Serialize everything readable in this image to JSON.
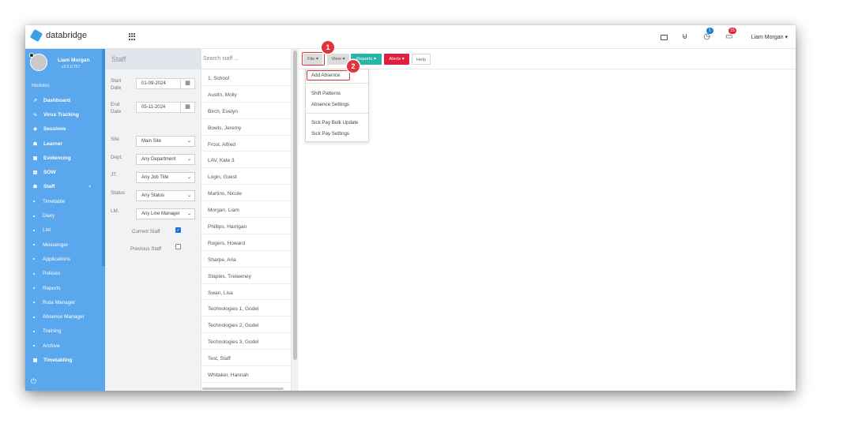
{
  "topbar": {
    "brand": "databridge",
    "notifications_count": "1",
    "messages_count": "15",
    "user": "Liam Morgan ▾"
  },
  "sidebar": {
    "profile_name": "Liam Morgan",
    "version": "v2.0.0.757",
    "modules_label": "Modules",
    "items": [
      {
        "label": "Dashboard",
        "icon": "chart-line-icon",
        "glyph": "↗"
      },
      {
        "label": "Virus Tracking",
        "icon": "pulse-icon",
        "glyph": "∿"
      },
      {
        "label": "Sessions",
        "icon": "layers-icon",
        "glyph": "◈"
      },
      {
        "label": "Learner",
        "icon": "users-icon",
        "glyph": "☗"
      },
      {
        "label": "Evidencing",
        "icon": "camera-icon",
        "glyph": "▣"
      },
      {
        "label": "SOW",
        "icon": "book-icon",
        "glyph": "▤"
      },
      {
        "label": "Staff",
        "icon": "staff-icon",
        "glyph": "☗"
      }
    ],
    "sub_items": [
      "Timetable",
      "Diary",
      "List",
      "Messenger",
      "Applications",
      "Policies",
      "Reports",
      "Rota Manager",
      "Absence Manager",
      "Training",
      "Archive"
    ],
    "timetabling_label": "Timetabling"
  },
  "filter": {
    "title": "Staff",
    "start_label": "Start Date",
    "start_value": "01-09-2024",
    "end_label": "End Date",
    "end_value": "05-11-2024",
    "site_label": "Site",
    "site_value": "Main Site",
    "dept_label": "Dept.",
    "dept_value": "Any Department",
    "jt_label": "JT.",
    "jt_value": "Any Job Title",
    "status_label": "Status",
    "status_value": "Any Status",
    "lm_label": "LM.",
    "lm_value": "Any Line Manager",
    "current_staff_label": "Current Staff",
    "current_staff_checked": true,
    "previous_staff_label": "Previous Staff",
    "previous_staff_checked": false
  },
  "staff_list": {
    "search_placeholder": "Search staff ...",
    "rows": [
      "1, School",
      "Austin, Molly",
      "Birch, Evelyn",
      "Bowls, Jeremy",
      "Frost, Alfred",
      "LAV, Kate 3",
      "Login, Guest",
      "Martins, Nicole",
      "Morgan, Liam",
      "Phillips, Harrigan",
      "Rogers, Howard",
      "Sharpe, Aria",
      "Staples, Trelawney",
      "Swan, Lisa",
      "Technologies 1, Godel",
      "Technologies 2, Godel",
      "Technologies 3, Godel",
      "Test, Staff",
      "Whitaker, Hannah"
    ]
  },
  "toolbar": {
    "file": "File ▾",
    "view": "View ▾",
    "reports": "Reports ▾",
    "alerts": "Alerts ▾",
    "help": "Help"
  },
  "file_menu": {
    "add_absence": "Add Absence",
    "shift_patterns": "Shift Patterns",
    "absence_settings": "Absence Settings",
    "sick_pay_bulk_update": "Sick Pay Bulk Update",
    "sick_pay_settings": "Sick Pay Settings"
  },
  "markers": {
    "step1": "1",
    "step2": "2"
  },
  "colors": {
    "sidebar": "#5aa7ee",
    "reports": "#27b5a5",
    "alerts": "#df1f3d",
    "highlight": "#d9333b"
  }
}
